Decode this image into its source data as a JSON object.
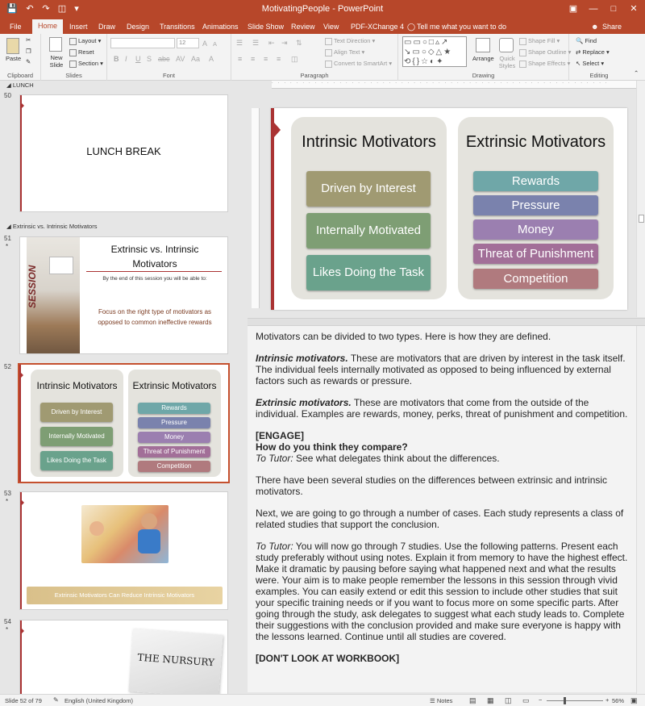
{
  "window": {
    "title": "MotivatingPeople - PowerPoint"
  },
  "menu": {
    "tabs": [
      "File",
      "Home",
      "Insert",
      "Draw",
      "Design",
      "Transitions",
      "Animations",
      "Slide Show",
      "Review",
      "View",
      "PDF-XChange 4"
    ],
    "active": "Home",
    "tell_me": "Tell me what you want to do",
    "share": "Share"
  },
  "ribbon": {
    "clipboard": {
      "label": "Clipboard",
      "paste": "Paste"
    },
    "slides": {
      "label": "Slides",
      "new_slide": "New Slide",
      "layout": "Layout",
      "reset": "Reset",
      "section": "Section"
    },
    "font": {
      "label": "Font",
      "size": "12"
    },
    "paragraph": {
      "label": "Paragraph",
      "text_direction": "Text Direction",
      "align_text": "Align Text",
      "convert": "Convert to SmartArt"
    },
    "drawing": {
      "label": "Drawing",
      "arrange": "Arrange",
      "quick_styles": "Quick Styles",
      "shape_fill": "Shape Fill",
      "shape_outline": "Shape Outline",
      "shape_effects": "Shape Effects"
    },
    "editing": {
      "label": "Editing",
      "find": "Find",
      "replace": "Replace",
      "select": "Select"
    }
  },
  "thumbs": {
    "section_lunch": "LUNCH",
    "section_ext": "Extrinsic vs. Intrinsic Motivators",
    "s50": {
      "num": "50",
      "title": "LUNCH BREAK"
    },
    "s51": {
      "num": "51",
      "title1": "Extrinsic vs. Intrinsic",
      "title2": "Motivators",
      "vert": "SESSION",
      "line1": "By the end of this session you will be able to:",
      "line2": "Focus on the right type of motivators as",
      "line3": "opposed to common ineffective rewards"
    },
    "s52": {
      "num": "52"
    },
    "s53": {
      "num": "53",
      "banner": "Extrinsic Motivators Can Reduce Intrinsic Motivators"
    },
    "s54": {
      "num": "54",
      "title": "THE NURSURY"
    },
    "star": "*"
  },
  "slide": {
    "intrinsic_title": "Intrinsic Motivators",
    "intrinsic_items": [
      "Driven by Interest",
      "Internally Motivated",
      "Likes Doing the Task"
    ],
    "extrinsic_title": "Extrinsic Motivators",
    "extrinsic_items": [
      "Rewards",
      "Pressure",
      "Money",
      "Threat of Punishment",
      "Competition"
    ]
  },
  "notes": {
    "p1": "Motivators can be divided to two types. Here is how they are defined.",
    "p2_b": "Intrinsic motivators.",
    "p2": " These are motivators that are driven by interest in the task itself. The individual feels internally motivated as opposed to being influenced by external factors such as rewards or pressure.",
    "p3_b": "Extrinsic motivators.",
    "p3": " These are motivators that come from the outside of the individual. Examples are rewards, money, perks, threat of punishment and competition.",
    "engage": "[ENGAGE]",
    "question": "How do you think they compare?",
    "tutor1_label": "To Tutor:",
    "tutor1": " See what delegates think about the differences.",
    "p5": "There have been several studies on the differences between extrinsic and intrinsic motivators.",
    "p6": "Next, we are going to go through a number of cases. Each study represents a class of related studies that support the conclusion.",
    "tutor2_label": "To Tutor:",
    "tutor2": " You will now go through 7 studies. Use the following patterns. Present each study preferably without using notes. Explain it from memory to have the highest effect. Make it dramatic by pausing before saying what happened next and what the results were. Your aim is to make people remember the lessons in this session through vivid examples. You can easily extend or edit this session to include other studies that suit your specific training needs or if you want to focus more on some specific parts. After going through the study, ask delegates to suggest what each study leads to. Complete their suggestions with the conclusion provided and make sure everyone is happy with the lessons learned. Continue until all studies are covered.",
    "dont": "[DON'T LOOK AT WORKBOOK]"
  },
  "status": {
    "slide": "Slide 52 of 79",
    "language": "English (United Kingdom)",
    "notes": "Notes",
    "zoom": "56%"
  },
  "colors": {
    "accent": "#b7472a",
    "intrinsic": [
      "#a09a72",
      "#7e9e74",
      "#6aa28c"
    ],
    "extrinsic": [
      "#6fa7a8",
      "#7a82ad",
      "#9b7fb0",
      "#a26f98",
      "#b07a7e"
    ]
  }
}
